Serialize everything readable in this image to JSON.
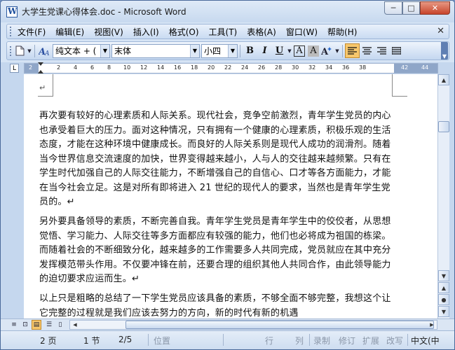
{
  "window": {
    "title": "大学生党课心得体会.doc - Microsoft Word",
    "min_label": "─",
    "max_label": "□",
    "close_label": "✕"
  },
  "menu": {
    "items": [
      "文件(F)",
      "编辑(E)",
      "视图(V)",
      "插入(I)",
      "格式(O)",
      "工具(T)",
      "表格(A)",
      "窗口(W)",
      "帮助(H)"
    ],
    "close_doc": "✕"
  },
  "toolbar": {
    "style_value": "纯文本 + (",
    "font_value": "末体",
    "size_value": "小四",
    "bold_label": "B",
    "italic_label": "I",
    "underline_label": "U",
    "border_label": "A",
    "shading_label": "A"
  },
  "ruler": {
    "numbers": [
      "2",
      "2",
      "4",
      "6",
      "8",
      "10",
      "12",
      "14",
      "16",
      "18",
      "20",
      "22",
      "24",
      "26",
      "28",
      "30",
      "32",
      "34",
      "36",
      "38",
      "42",
      "44"
    ],
    "corner": "L"
  },
  "document": {
    "para1": "再次要有较好的心理素质和人际关系。现代社会，竞争空前激烈，青年学生党员的内心也承受着巨大的压力。面对这种情况，只有拥有一个健康的心理素质，积极乐观的生活态度，才能在这种环境中健康成长。而良好的人际关系则是现代人成功的润滑剂。随着当今世界信息交流速度的加快，世界变得越来越小，人与人的交往越来越频繁。只有在学生时代加强自己的人际交往能力，不断增强自己的自信心、口才等各方面能力，才能在当今社会立足。这是对所有即将进入 21 世纪的现代人的要求，当然也是青年学生党员的。↵",
    "para2": "另外要具备领导的素质，不断完善自我。青年学生党员是青年学生中的佼佼者，从思想觉悟、学习能力、人际交往等多方面都应有较强的能力，他们也必将成为祖国的栋梁。而随着社会的不断细致分化，越来越多的工作需要多人共同完成，党员就应在其中充分发挥模范带头作用。不仅要冲锋在前，还要合理的组织其他人共同合作，由此领导能力的迫切要求应运而生。↵",
    "para3": "以上只是粗略的总结了一下学生党员应该具备的素质，不够全面不够完整，我想这个让它完整的过程就是我们应该去努力的方向，新的时代有新的机遇",
    "para_mark": "↵"
  },
  "status": {
    "page": "2 页",
    "section": "1 节",
    "page_of": "2/5",
    "position": "位置",
    "line": "行",
    "column": "列",
    "record": "录制",
    "revise": "修订",
    "extend": "扩展",
    "overwrite": "改写",
    "language": "中文(中"
  }
}
